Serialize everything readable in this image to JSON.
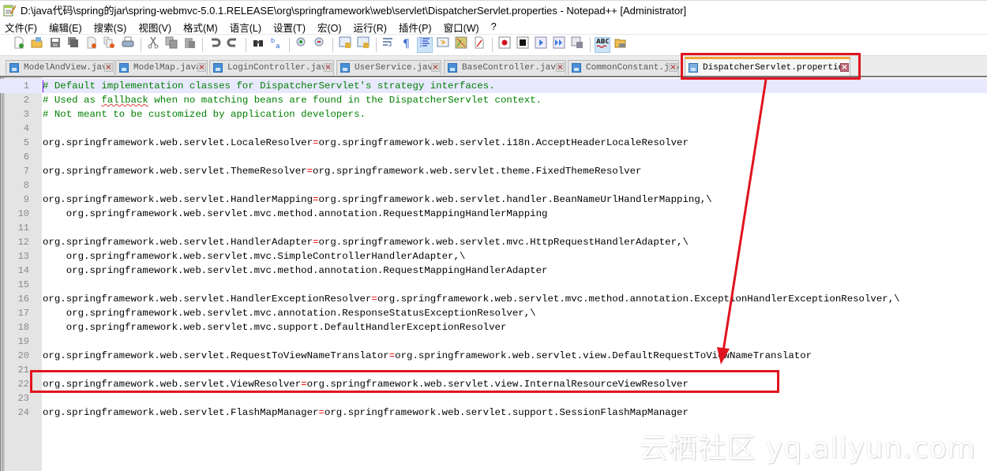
{
  "window": {
    "title": "D:\\java代码\\spring的jar\\spring-webmvc-5.0.1.RELEASE\\org\\springframework\\web\\servlet\\DispatcherServlet.properties - Notepad++ [Administrator]"
  },
  "menu": [
    {
      "label": "文件(F)"
    },
    {
      "label": "编辑(E)"
    },
    {
      "label": "搜索(S)"
    },
    {
      "label": "视图(V)"
    },
    {
      "label": "格式(M)"
    },
    {
      "label": "语言(L)"
    },
    {
      "label": "设置(T)"
    },
    {
      "label": "宏(O)"
    },
    {
      "label": "运行(R)"
    },
    {
      "label": "插件(P)"
    },
    {
      "label": "窗口(W)"
    },
    {
      "label": "?"
    }
  ],
  "toolbar": {
    "groups": [
      [
        "new-file-icon",
        "open-file-icon",
        "save-icon",
        "save-all-icon",
        "close-icon",
        "close-all-icon",
        "print-icon"
      ],
      [
        "cut-icon",
        "copy-icon",
        "paste-icon"
      ],
      [
        "undo-icon",
        "redo-icon"
      ],
      [
        "find-icon",
        "replace-icon"
      ],
      [
        "zoom-in-icon",
        "zoom-out-icon"
      ],
      [
        "sync-vertical-icon",
        "sync-horizontal-icon"
      ],
      [
        "word-wrap-icon",
        "show-all-chars-icon",
        "indent-guide-icon",
        "doc-map-icon",
        "function-list-icon",
        "folder-as-workspace-icon"
      ],
      [
        "record-macro-icon",
        "stop-recording-icon",
        "play-macro-icon",
        "run-macro-multiple-icon",
        "save-macro-icon"
      ],
      [
        "spell-check-icon",
        "open-in-explorer-icon"
      ]
    ],
    "active": [
      "indent-guide-icon",
      "spell-check-icon"
    ]
  },
  "tabs": [
    {
      "label": "ModelAndView.java",
      "active": false
    },
    {
      "label": "ModelMap.java",
      "active": false
    },
    {
      "label": "LoginController.java",
      "active": false
    },
    {
      "label": "UserService.java",
      "active": false
    },
    {
      "label": "BaseController.java",
      "active": false
    },
    {
      "label": "CommonConstant.java",
      "active": false
    },
    {
      "label": "DispatcherServlet.properties",
      "active": true
    }
  ],
  "editor": {
    "current_line": 1,
    "lines": [
      {
        "n": "1",
        "type": "comment",
        "text": "# Default implementation classes for DispatcherServlet's strategy interfaces."
      },
      {
        "n": "2",
        "type": "comment",
        "text": "# Used as fallback when no matching beans are found in the DispatcherServlet context.",
        "squiggle": "fallback"
      },
      {
        "n": "3",
        "type": "comment",
        "text": "# Not meant to be customized by application developers."
      },
      {
        "n": "4",
        "type": "blank",
        "text": ""
      },
      {
        "n": "5",
        "type": "prop",
        "key": "org.springframework.web.servlet.LocaleResolver",
        "value": "org.springframework.web.servlet.i18n.AcceptHeaderLocaleResolver"
      },
      {
        "n": "6",
        "type": "blank",
        "text": ""
      },
      {
        "n": "7",
        "type": "prop",
        "key": "org.springframework.web.servlet.ThemeResolver",
        "value": "org.springframework.web.servlet.theme.FixedThemeResolver"
      },
      {
        "n": "8",
        "type": "blank",
        "text": ""
      },
      {
        "n": "9",
        "type": "prop",
        "key": "org.springframework.web.servlet.HandlerMapping",
        "value": "org.springframework.web.servlet.handler.BeanNameUrlHandlerMapping,\\"
      },
      {
        "n": "10",
        "type": "cont",
        "text": "    org.springframework.web.servlet.mvc.method.annotation.RequestMappingHandlerMapping"
      },
      {
        "n": "11",
        "type": "blank",
        "text": ""
      },
      {
        "n": "12",
        "type": "prop",
        "key": "org.springframework.web.servlet.HandlerAdapter",
        "value": "org.springframework.web.servlet.mvc.HttpRequestHandlerAdapter,\\"
      },
      {
        "n": "13",
        "type": "cont",
        "text": "    org.springframework.web.servlet.mvc.SimpleControllerHandlerAdapter,\\"
      },
      {
        "n": "14",
        "type": "cont",
        "text": "    org.springframework.web.servlet.mvc.method.annotation.RequestMappingHandlerAdapter"
      },
      {
        "n": "15",
        "type": "blank",
        "text": ""
      },
      {
        "n": "16",
        "type": "prop",
        "key": "org.springframework.web.servlet.HandlerExceptionResolver",
        "value": "org.springframework.web.servlet.mvc.method.annotation.ExceptionHandlerExceptionResolver,\\"
      },
      {
        "n": "17",
        "type": "cont",
        "text": "    org.springframework.web.servlet.mvc.annotation.ResponseStatusExceptionResolver,\\"
      },
      {
        "n": "18",
        "type": "cont",
        "text": "    org.springframework.web.servlet.mvc.support.DefaultHandlerExceptionResolver"
      },
      {
        "n": "19",
        "type": "blank",
        "text": ""
      },
      {
        "n": "20",
        "type": "prop",
        "key": "org.springframework.web.servlet.RequestToViewNameTranslator",
        "value": "org.springframework.web.servlet.view.DefaultRequestToViewNameTranslator"
      },
      {
        "n": "21",
        "type": "blank",
        "text": ""
      },
      {
        "n": "22",
        "type": "prop",
        "key": "org.springframework.web.servlet.ViewResolver",
        "value": "org.springframework.web.servlet.view.InternalResourceViewResolver"
      },
      {
        "n": "23",
        "type": "blank",
        "text": ""
      },
      {
        "n": "24",
        "type": "prop",
        "key": "org.springframework.web.servlet.FlashMapManager",
        "value": "org.springframework.web.servlet.support.SessionFlashMapManager"
      }
    ]
  },
  "annotations": {
    "highlighted_tab": "DispatcherServlet.properties",
    "highlighted_line": "22",
    "color": "#e0141e"
  },
  "watermark": "云栖社区 yq.aliyun.com"
}
